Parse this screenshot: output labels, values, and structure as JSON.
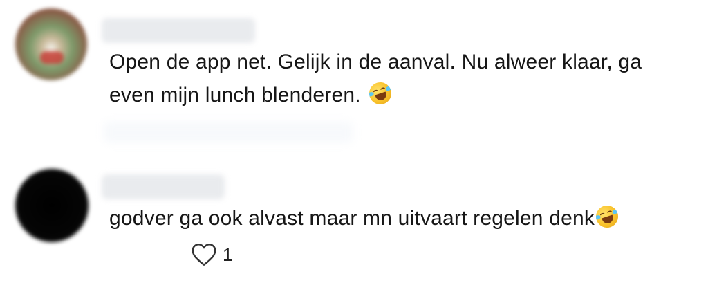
{
  "comments": [
    {
      "text_line1": "Open de app net. Gelijk in de aanval. Nu alweer klaar, ga",
      "text_line2": "even mijn lunch blenderen.",
      "emoji": "rolling-on-floor-laughing-emoji",
      "avatar_colors": [
        "#b6a57c",
        "#7d4a3a",
        "#6f8f5f",
        "#cc3a35"
      ]
    },
    {
      "text_line1": "godver ga ook alvast maar mn uitvaart regelen denk",
      "emoji": "rolling-on-floor-laughing-emoji",
      "avatar_colors": [
        "#101010",
        "#000000"
      ],
      "like_count": "1"
    }
  ],
  "icons": {
    "like": "heart-outline-icon"
  },
  "colors": {
    "text": "#161616",
    "placeholder": "#e9ebee"
  }
}
